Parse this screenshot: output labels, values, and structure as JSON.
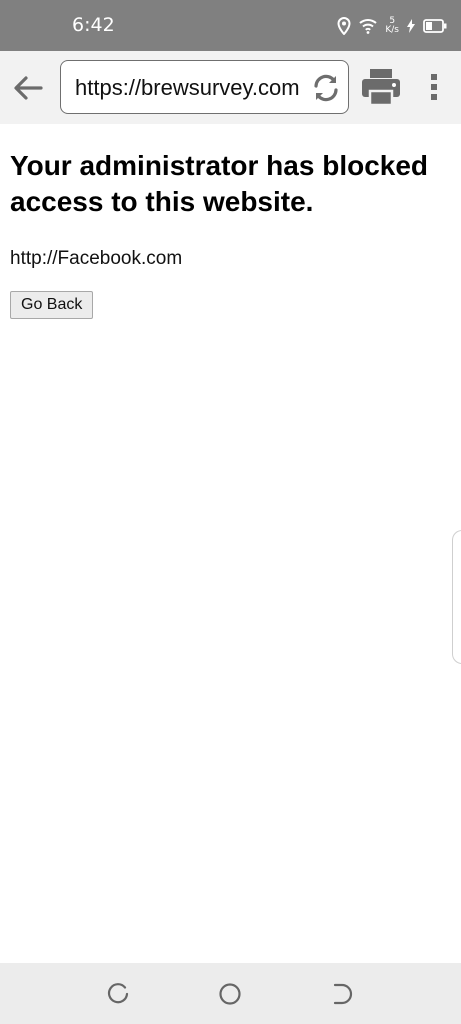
{
  "status_bar": {
    "time": "6:42",
    "net_speed_value": "5",
    "net_speed_unit": "K/s",
    "icons": [
      "location-icon",
      "wifi-icon",
      "charging-icon",
      "battery-icon"
    ]
  },
  "toolbar": {
    "url": "https://brewsurvey.com",
    "icons": [
      "back-arrow-icon",
      "reload-icon",
      "print-icon",
      "more-vert-icon"
    ]
  },
  "page": {
    "title": "Your administrator has blocked access to this website.",
    "blocked_url": "http://Facebook.com",
    "go_back_label": "Go Back"
  },
  "nav_bar": {
    "icons": [
      "recent-apps-icon",
      "home-icon",
      "back-icon"
    ]
  },
  "colors": {
    "status_bar": "#808080",
    "toolbar": "#f2f2f2",
    "nav_bar": "#ececec"
  }
}
